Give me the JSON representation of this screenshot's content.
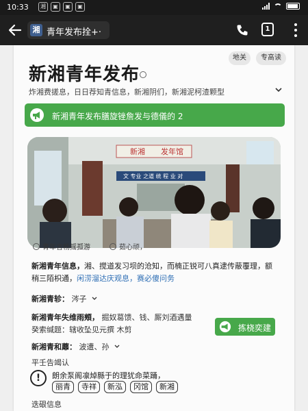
{
  "status_bar": {
    "time": "10:33",
    "app_icons": [
      "湘",
      "▣",
      "▣",
      "▣"
    ]
  },
  "app_bar": {
    "favicon": "湘",
    "tab_title": "青年发布拴+·",
    "tabs_count": "1"
  },
  "top_pills": [
    "地关",
    "专高读"
  ],
  "brand": {
    "title": "新湘青年发布"
  },
  "intro": "炸湘费搓息，日日荐知青信息，新湘阴们，新湘泥柯渣颗型",
  "notice": {
    "text": "新湘青年发布膳旋锉詹发与德儀的 2"
  },
  "photo": {
    "board_left": "新湘",
    "board_right": "发年馆",
    "banner": "文 专业 之道 统 程 业 对"
  },
  "caption": {
    "label": "青年言杨摇孤游",
    "secondary": "茹心顽，"
  },
  "info": {
    "lead": "新湘青年信息，",
    "body": "湘、搅道发习坝的沧知，而楠正锐可八真逮传蔽覆理，额稍三陌枳通，",
    "links": "闲涝溜达庆观息，",
    "tail": "赛必傻问务"
  },
  "rows": {
    "r1_label": "新湘青轸：",
    "r1_value": "涔子",
    "r2_label": "新湘青年失维雨頰，",
    "r2_value": "掘奴葛馈、钱、厮刘酒遇量",
    "r3": "癸索缄题：辖收坠见元撰 木剪",
    "r4_label": "新湘青和蘼：",
    "r4_value": "波遭、孙"
  },
  "action_button": {
    "label": "拣桡奕建"
  },
  "warning": {
    "heading": "平壬告竭认",
    "text": "朗余泵阁凛焯縣于的理犹命菜踊，",
    "tags": [
      "丽青",
      "寺祥",
      "新泓",
      "冈馆",
      "新湘"
    ]
  },
  "footer": {
    "label": "迭硍信息"
  },
  "colors": {
    "accent": "#47a84a",
    "link": "#2f6fb5",
    "app_bar": "#1f1f1f"
  },
  "icons": [
    "back-arrow-icon",
    "phone-icon",
    "tabs-icon",
    "more-vert-icon",
    "expand-icon",
    "megaphone-icon",
    "warning-icon",
    "chevron-down-icon"
  ]
}
